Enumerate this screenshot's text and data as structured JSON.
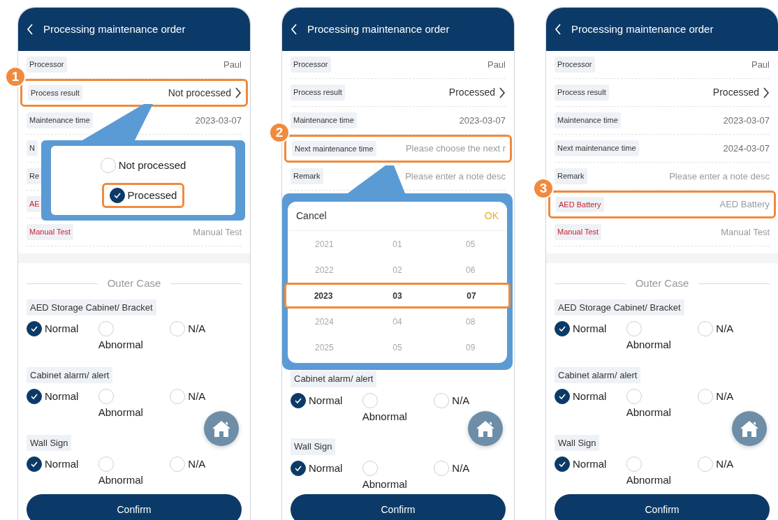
{
  "phones": [
    {
      "step": "1",
      "title": "Processing maintenance order",
      "fields": [
        {
          "label": "Processor",
          "kind": "text",
          "value": "Paul",
          "required": false,
          "highlighted": false
        },
        {
          "label": "Process result",
          "kind": "select",
          "value": "Not processed",
          "required": false,
          "highlighted": true
        },
        {
          "label": "Maintenance time",
          "kind": "text",
          "value": "2023-03-07",
          "required": false,
          "highlighted": false
        },
        {
          "label": "N",
          "kind": "text",
          "required": false,
          "highlighted": false
        },
        {
          "label": "Re",
          "kind": "text",
          "required": false,
          "highlighted": false
        },
        {
          "label": "AE",
          "kind": "text",
          "required": true,
          "highlighted": false
        },
        {
          "label": "Manual Test",
          "kind": "input",
          "placeholder": "Manual Test",
          "required": true,
          "highlighted": false
        }
      ],
      "popup": {
        "options": [
          {
            "label": "Not processed",
            "selected": false
          },
          {
            "label": "Processed",
            "selected": true
          }
        ]
      },
      "section": "Outer Case",
      "groups": [
        {
          "label": "AED Storage Cabinet/ Bracket",
          "options": [
            {
              "label": "Normal",
              "selected": true
            },
            {
              "label": "Abnormal",
              "selected": false
            },
            {
              "label": "N/A",
              "selected": false
            }
          ]
        },
        {
          "label": "Cabinet alarm/ alert",
          "options": [
            {
              "label": "Normal",
              "selected": true
            },
            {
              "label": "Abnormal",
              "selected": false
            },
            {
              "label": "N/A",
              "selected": false
            }
          ]
        },
        {
          "label": "Wall Sign",
          "options": [
            {
              "label": "Normal",
              "selected": true
            },
            {
              "label": "Abnormal",
              "selected": false
            },
            {
              "label": "N/A",
              "selected": false
            }
          ]
        }
      ],
      "confirm": "Confirm"
    },
    {
      "step": "2",
      "title": "Processing maintenance order",
      "fields": [
        {
          "label": "Processor",
          "kind": "text",
          "value": "Paul",
          "required": false,
          "highlighted": false
        },
        {
          "label": "Process result",
          "kind": "select",
          "value": "Processed",
          "required": false,
          "highlighted": false
        },
        {
          "label": "Maintenance time",
          "kind": "text",
          "value": "2023-03-07",
          "required": false,
          "highlighted": false
        },
        {
          "label": "Next maintenance time",
          "kind": "input",
          "placeholder": "Please choose the next r",
          "required": false,
          "highlighted": true
        },
        {
          "label": "Remark",
          "kind": "input",
          "placeholder": "Please enter a note desc",
          "required": false,
          "highlighted": false
        }
      ],
      "picker": {
        "cancel": "Cancel",
        "ok": "OK",
        "rows": [
          {
            "values": [
              "2021",
              "01",
              "05"
            ],
            "selected": false
          },
          {
            "values": [
              "2022",
              "02",
              "06"
            ],
            "selected": false
          },
          {
            "values": [
              "2023",
              "03",
              "07"
            ],
            "selected": true
          },
          {
            "values": [
              "2024",
              "04",
              "08"
            ],
            "selected": false
          },
          {
            "values": [
              "2025",
              "05",
              "09"
            ],
            "selected": false
          }
        ]
      },
      "groups": [
        {
          "label": "Cabinet alarm/ alert",
          "options": [
            {
              "label": "Normal",
              "selected": true
            },
            {
              "label": "Abnormal",
              "selected": false
            },
            {
              "label": "N/A",
              "selected": false
            }
          ]
        },
        {
          "label": "Wall Sign",
          "options": [
            {
              "label": "Normal",
              "selected": true
            },
            {
              "label": "Abnormal",
              "selected": false
            },
            {
              "label": "N/A",
              "selected": false
            }
          ]
        }
      ],
      "confirm": "Confirm"
    },
    {
      "step": "3",
      "title": "Processing maintenance order",
      "fields": [
        {
          "label": "Processor",
          "kind": "text",
          "value": "Paul",
          "required": false,
          "highlighted": false
        },
        {
          "label": "Process result",
          "kind": "select",
          "value": "Processed",
          "required": false,
          "highlighted": false
        },
        {
          "label": "Maintenance time",
          "kind": "text",
          "value": "2023-03-07",
          "required": false,
          "highlighted": false
        },
        {
          "label": "Next maintenance time",
          "kind": "text",
          "value": "2024-03-07",
          "required": false,
          "highlighted": false
        },
        {
          "label": "Remark",
          "kind": "input",
          "placeholder": "Please enter a note desc",
          "required": false,
          "highlighted": false
        },
        {
          "label": "AED Battery",
          "kind": "input",
          "placeholder": "AED Battery",
          "required": true,
          "highlighted": true
        },
        {
          "label": "Manual Test",
          "kind": "input",
          "placeholder": "Manual Test",
          "required": true,
          "highlighted": false
        }
      ],
      "section": "Outer Case",
      "groups": [
        {
          "label": "AED Storage Cabinet/ Bracket",
          "options": [
            {
              "label": "Normal",
              "selected": true
            },
            {
              "label": "Abnormal",
              "selected": false
            },
            {
              "label": "N/A",
              "selected": false
            }
          ]
        },
        {
          "label": "Cabinet alarm/ alert",
          "options": [
            {
              "label": "Normal",
              "selected": true
            },
            {
              "label": "Abnormal",
              "selected": false
            },
            {
              "label": "N/A",
              "selected": false
            }
          ]
        },
        {
          "label": "Wall Sign",
          "options": [
            {
              "label": "Normal",
              "selected": true
            },
            {
              "label": "Abnormal",
              "selected": false
            },
            {
              "label": "N/A",
              "selected": false
            }
          ]
        }
      ],
      "confirm": "Confirm"
    }
  ]
}
